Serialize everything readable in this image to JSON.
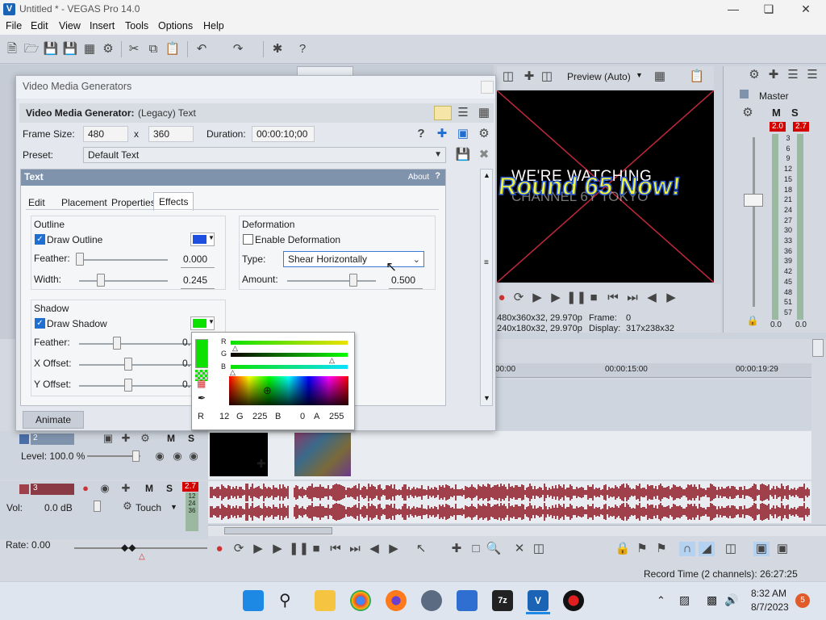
{
  "window": {
    "title": "Untitled * - VEGAS Pro 14.0"
  },
  "menu": [
    "File",
    "Edit",
    "View",
    "Insert",
    "Tools",
    "Options",
    "Help"
  ],
  "preview": {
    "mode_label": "Preview (Auto)",
    "overlay_line1": "WE'RE WATCHING",
    "overlay_line2": "Round 65 Now!",
    "overlay_line3": "CHANNEL 6Y TOKYO",
    "project_info": "480x360x32, 29.970p",
    "preview_info": "240x180x32, 29.970p",
    "frame_label": "Frame:",
    "frame_value": "0",
    "display_label": "Display:",
    "display_value": "317x238x32"
  },
  "mixer": {
    "title": "Master",
    "left_peak": "2.0",
    "right_peak": "2.7",
    "scale": [
      "3",
      "6",
      "9",
      "12",
      "15",
      "18",
      "21",
      "24",
      "27",
      "30",
      "33",
      "36",
      "39",
      "42",
      "45",
      "48",
      "51",
      "57"
    ],
    "left_level": "0.0",
    "right_level": "0.0"
  },
  "dialog": {
    "title": "Video Media Generators",
    "generator_label": "Video Media Generator:",
    "generator_value": "(Legacy) Text",
    "frame_size_label": "Frame Size:",
    "frame_w": "480",
    "x_label": "x",
    "frame_h": "360",
    "duration_label": "Duration:",
    "duration_value": "00:00:10;00",
    "preset_label": "Preset:",
    "preset_value": "Default Text",
    "panel_title": "Text",
    "about": "About",
    "tabs": [
      "Edit",
      "Placement",
      "Properties",
      "Effects"
    ],
    "outline": {
      "section": "Outline",
      "draw_label": "Draw Outline",
      "color": "#1f4fe0",
      "feather_label": "Feather:",
      "feather_value": "0.000",
      "feather_fraction": 0.0,
      "width_label": "Width:",
      "width_value": "0.245",
      "width_fraction": 0.245
    },
    "deformation": {
      "section": "Deformation",
      "enable_label": "Enable Deformation",
      "type_label": "Type:",
      "type_value": "Shear Horizontally",
      "amount_label": "Amount:",
      "amount_value": "0.500",
      "amount_fraction": 0.75
    },
    "shadow": {
      "section": "Shadow",
      "draw_label": "Draw Shadow",
      "color": "#0ce100",
      "feather_label": "Feather:",
      "feather_value": "0.",
      "x_label": "X Offset:",
      "x_value": "0.",
      "y_label": "Y Offset:",
      "y_value": "0."
    },
    "color_picker": {
      "r_label": "R",
      "g_label": "G",
      "b_label": "B",
      "a_label": "A",
      "r": "12",
      "g": "225",
      "b": "0",
      "a": "255"
    },
    "animate": "Animate"
  },
  "timeline": {
    "ruler": [
      "00:00",
      "00:00:15:00",
      "00:00:19:29"
    ],
    "video_track_num": "2",
    "level_label": "Level: 100.0 %",
    "audio_track_num": "3",
    "vol_label": "Vol:",
    "vol_value": "0.0 dB",
    "touch_label": "Touch",
    "audio_peak": "2.7",
    "audio_scale": [
      "12",
      "24",
      "36"
    ],
    "rate_label": "Rate: 0.00"
  },
  "status": {
    "record_time": "Record Time (2 channels): 26:27:25"
  },
  "taskbar": {
    "time": "8:32 AM",
    "date": "8/7/2023",
    "badge": "5"
  }
}
